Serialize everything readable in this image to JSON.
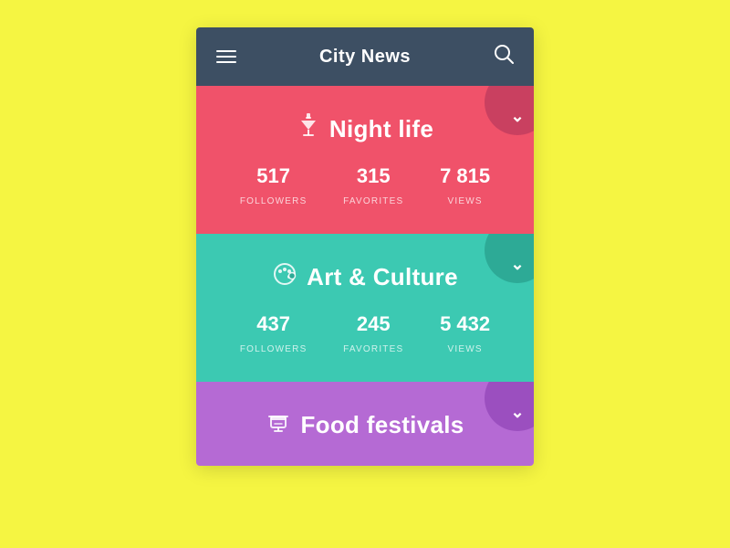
{
  "header": {
    "title": "City News",
    "hamburger_label": "menu",
    "search_label": "search"
  },
  "cards": [
    {
      "id": "nightlife",
      "title": "Night life",
      "icon": "cocktail",
      "stats": [
        {
          "number": "517",
          "label": "FOLLOWERS"
        },
        {
          "number": "315",
          "label": "FAVORITES"
        },
        {
          "number": "7 815",
          "label": "VIEWS"
        }
      ]
    },
    {
      "id": "artculture",
      "title": "Art & Culture",
      "icon": "palette",
      "stats": [
        {
          "number": "437",
          "label": "FOLLOWERS"
        },
        {
          "number": "245",
          "label": "FAVORITES"
        },
        {
          "number": "5 432",
          "label": "VIEWS"
        }
      ]
    },
    {
      "id": "food",
      "title": "Food festivals",
      "icon": "food",
      "stats": []
    }
  ]
}
